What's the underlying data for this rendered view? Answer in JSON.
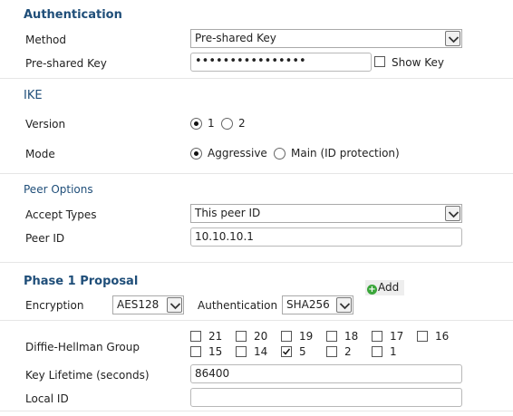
{
  "authentication": {
    "heading": "Authentication",
    "method_label": "Method",
    "method_value": "Pre-shared Key",
    "psk_label": "Pre-shared Key",
    "psk_value": "••••••••••••••••",
    "show_key_label": "Show Key",
    "show_key_checked": false
  },
  "ike": {
    "heading": "IKE",
    "version_label": "Version",
    "version_options": [
      "1",
      "2"
    ],
    "version_selected": "1",
    "mode_label": "Mode",
    "mode_options": [
      "Aggressive",
      "Main (ID protection)"
    ],
    "mode_selected": "Aggressive"
  },
  "peer_options": {
    "heading": "Peer Options",
    "accept_types_label": "Accept Types",
    "accept_types_value": "This peer ID",
    "peer_id_label": "Peer ID",
    "peer_id_value": "10.10.10.1"
  },
  "phase1": {
    "heading": "Phase 1 Proposal",
    "add_label": "Add",
    "encryption_label": "Encryption",
    "encryption_value": "AES128",
    "authentication_label": "Authentication",
    "authentication_value": "SHA256",
    "dh_label": "Diffie-Hellman Group",
    "dh_groups": [
      {
        "label": "21",
        "checked": false
      },
      {
        "label": "20",
        "checked": false
      },
      {
        "label": "19",
        "checked": false
      },
      {
        "label": "18",
        "checked": false
      },
      {
        "label": "17",
        "checked": false
      },
      {
        "label": "16",
        "checked": false
      },
      {
        "label": "15",
        "checked": false
      },
      {
        "label": "14",
        "checked": false
      },
      {
        "label": "5",
        "checked": true
      },
      {
        "label": "2",
        "checked": false
      },
      {
        "label": "1",
        "checked": false
      }
    ],
    "key_lifetime_label": "Key Lifetime (seconds)",
    "key_lifetime_value": "86400",
    "local_id_label": "Local ID",
    "local_id_value": ""
  },
  "icons": {
    "dropdown": "chevron-down-icon",
    "add": "plus-circle-icon"
  },
  "colors": {
    "heading": "#1f4e79",
    "add_icon": "#3aa63a"
  }
}
